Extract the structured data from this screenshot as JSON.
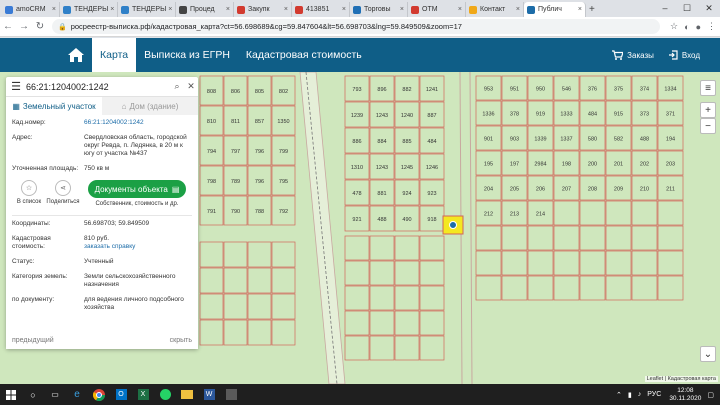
{
  "browser": {
    "tabs": [
      {
        "label": "amoCRM",
        "color": "#3a7bd5"
      },
      {
        "label": "ТЕНДЕРЫ",
        "color": "#2f80c8"
      },
      {
        "label": "ТЕНДЕРЫ",
        "color": "#2f80c8"
      },
      {
        "label": "Процед",
        "color": "#444444"
      },
      {
        "label": "Закупк",
        "color": "#d23a2f"
      },
      {
        "label": "413851",
        "color": "#d23a2f"
      },
      {
        "label": "Торговы",
        "color": "#1f6fb5"
      },
      {
        "label": "ОТМ",
        "color": "#d23a2f"
      },
      {
        "label": "Контакт",
        "color": "#f0a818"
      },
      {
        "label": "Публич",
        "color": "#1c6ca8",
        "active": true
      }
    ],
    "url": "росреестр-выписка.рф/кадастровая_карта?ct=56.698689&cg=59.847604&lt=56.698703&lng=59.849509&zoom=17"
  },
  "header": {
    "nav": [
      "Карта",
      "Выписка из ЕГРН",
      "Кадастровая стоимость"
    ],
    "active_nav": "Карта",
    "orders_label": "Заказы",
    "login_label": "Вход"
  },
  "panel": {
    "search_value": "66:21:1204002:1242",
    "tab_land": "Земельный участок",
    "tab_building": "Дом (здание)",
    "cadastral_label": "Кад.номер:",
    "cadastral_value": "66:21:1204002:1242",
    "address_label": "Адрес:",
    "address_value": "Свердловская область, городской округ Ревда, п. Ледянка, в 20 м к югу от участка №437",
    "area_label": "Уточненная площадь:",
    "area_value": "750 кв м",
    "list_label": "В список",
    "share_label": "Поделиться",
    "docs_button": "Документы объекта",
    "docs_sub": "Собственник, стоимость и др.",
    "coords_label": "Координаты:",
    "coords_value": "56.698703; 59.849509",
    "cost_label": "Кадастровая стоимость:",
    "cost_value": "810 руб.",
    "cost_link": "заказать справку",
    "status_label": "Статус:",
    "status_value": "Учтенный",
    "category_label": "Категория земель:",
    "category_value": "Земли сельскохозяйственного назначения",
    "usage_label": "по документу:",
    "usage_value": "для ведения личного подсобного хозяйства",
    "pager_prev": "предыдущий",
    "pager_collapse": "скрыть"
  },
  "map": {
    "parcels": [
      {
        "l": "808"
      },
      {
        "l": "806"
      },
      {
        "l": "805"
      },
      {
        "l": "802"
      },
      {
        "l": "810"
      },
      {
        "l": "811"
      },
      {
        "l": "857"
      },
      {
        "l": "1350"
      },
      {
        "l": "794"
      },
      {
        "l": "797"
      },
      {
        "l": "796"
      },
      {
        "l": "799"
      },
      {
        "l": "798"
      },
      {
        "l": "789"
      },
      {
        "l": "796"
      },
      {
        "l": "795"
      },
      {
        "l": "791"
      },
      {
        "l": "790"
      },
      {
        "l": "788"
      },
      {
        "l": "792"
      },
      {
        "l": "793"
      },
      {
        "l": "896"
      },
      {
        "l": "882"
      },
      {
        "l": "1241"
      },
      {
        "l": "1239"
      },
      {
        "l": "1243"
      },
      {
        "l": "1240"
      },
      {
        "l": "887"
      },
      {
        "l": "886"
      },
      {
        "l": "884"
      },
      {
        "l": "885"
      },
      {
        "l": "484"
      },
      {
        "l": "1310"
      },
      {
        "l": "1243"
      },
      {
        "l": "1245"
      },
      {
        "l": "1246"
      },
      {
        "l": "478"
      },
      {
        "l": "881"
      },
      {
        "l": "924"
      },
      {
        "l": "923"
      },
      {
        "l": "921"
      },
      {
        "l": "488"
      },
      {
        "l": "490"
      },
      {
        "l": "918"
      },
      {
        "l": "953"
      },
      {
        "l": "951"
      },
      {
        "l": "950"
      },
      {
        "l": "546"
      },
      {
        "l": "376"
      },
      {
        "l": "375"
      },
      {
        "l": "374"
      },
      {
        "l": "1334"
      },
      {
        "l": "1336"
      },
      {
        "l": "378"
      },
      {
        "l": "919"
      },
      {
        "l": "1333"
      },
      {
        "l": "484"
      },
      {
        "l": "915"
      },
      {
        "l": "373"
      },
      {
        "l": "371"
      },
      {
        "l": "901"
      },
      {
        "l": "903"
      },
      {
        "l": "1339"
      },
      {
        "l": "1337"
      },
      {
        "l": "580"
      },
      {
        "l": "582"
      },
      {
        "l": "488"
      },
      {
        "l": "194"
      },
      {
        "l": "195"
      },
      {
        "l": "197"
      },
      {
        "l": "2984"
      },
      {
        "l": "198"
      },
      {
        "l": "200"
      },
      {
        "l": "201"
      },
      {
        "l": "202"
      },
      {
        "l": "203"
      },
      {
        "l": "204"
      },
      {
        "l": "205"
      },
      {
        "l": "206"
      },
      {
        "l": "207"
      },
      {
        "l": "208"
      },
      {
        "l": "209"
      },
      {
        "l": "210"
      },
      {
        "l": "211"
      },
      {
        "l": "212"
      },
      {
        "l": "213"
      },
      {
        "l": "214"
      }
    ],
    "attribution": "Leaflet | Кадастровая карта"
  },
  "taskbar": {
    "lang": "РУС",
    "time": "12:08",
    "date": "30.11.2020"
  }
}
